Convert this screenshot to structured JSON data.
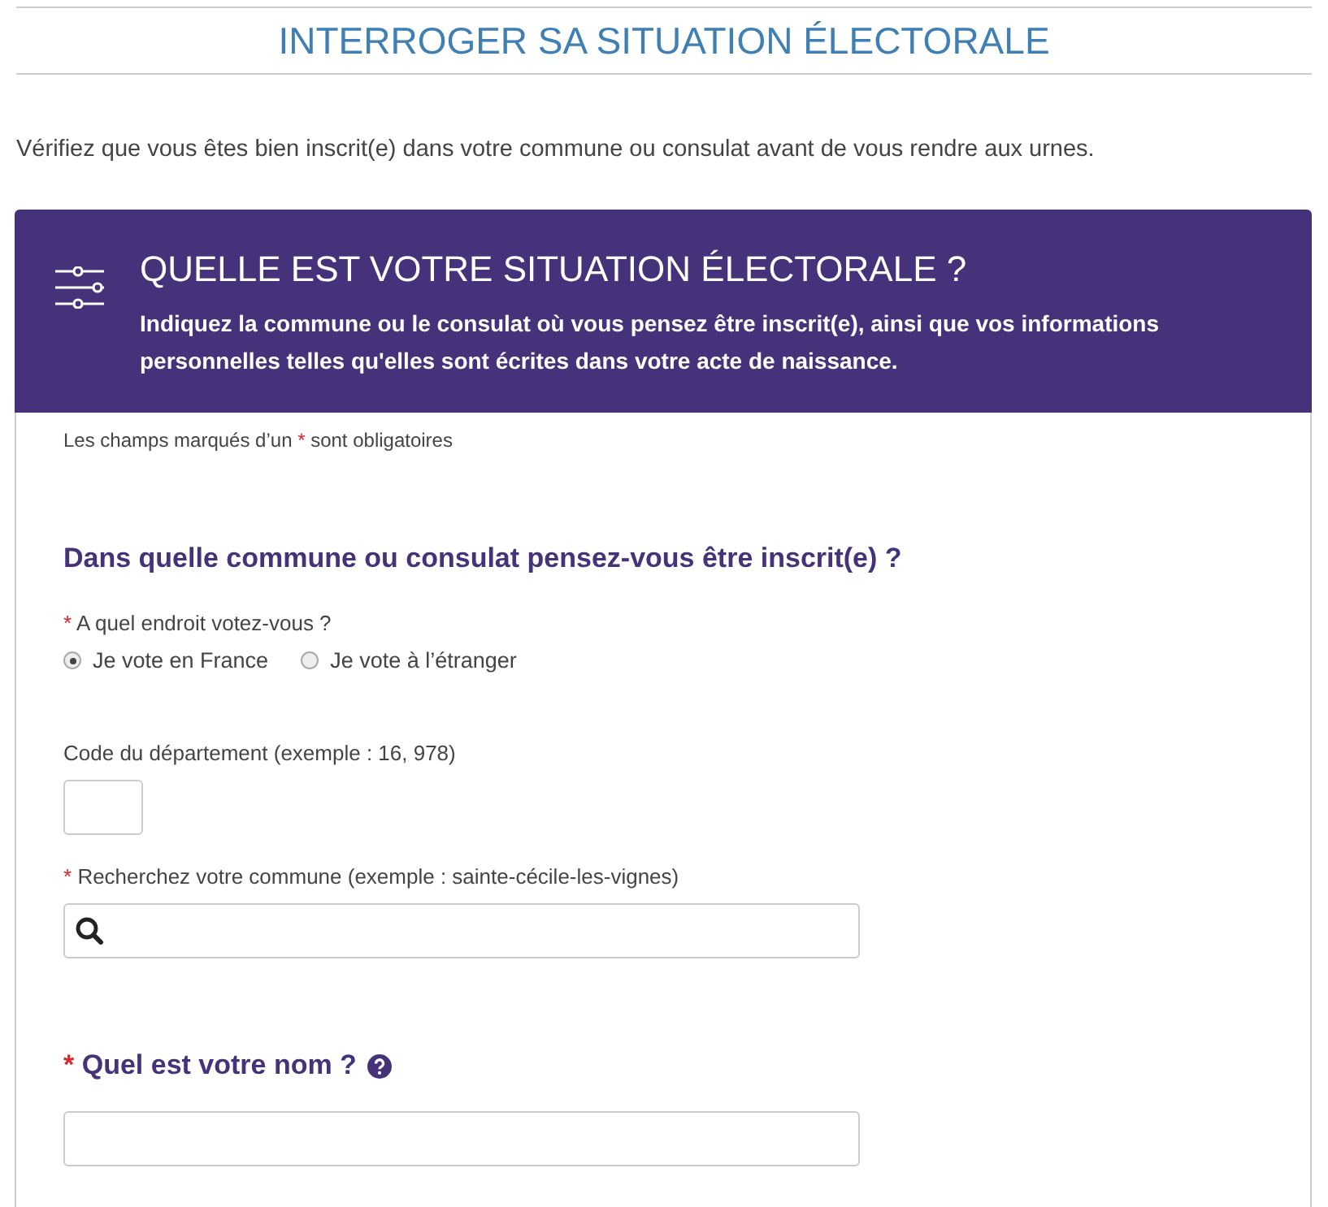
{
  "page_title": "INTERROGER SA SITUATION ÉLECTORALE",
  "intro": "Vérifiez que vous êtes bien inscrit(e) dans votre commune ou consulat avant de vous rendre aux urnes.",
  "card": {
    "title": "QUELLE EST VOTRE SITUATION ÉLECTORALE ?",
    "subtitle": "Indiquez la commune ou le consulat où vous pensez être inscrit(e), ainsi que vos informations personnelles telles qu'elles sont écrites dans votre acte de naissance."
  },
  "required_mark": "*",
  "notice": {
    "before": "Les champs marqués d’un",
    "after": "sont obligatoires"
  },
  "items": [
    {
      "kind": "heading",
      "label": "Dans quelle commune ou consulat pensez-vous être inscrit(e) ?"
    },
    {
      "kind": "radio",
      "label": "A quel endroit votez-vous ?",
      "required": true,
      "options": [
        {
          "label": "Je vote en France",
          "selected": true
        },
        {
          "label": "Je vote à l’étranger",
          "selected": false
        }
      ]
    },
    {
      "kind": "short_text",
      "label": "Code du département (exemple : 16, 978)",
      "required": false
    },
    {
      "kind": "search",
      "label": "Recherchez votre commune (exemple : sainte-cécile-les-vignes)",
      "required": true
    },
    {
      "kind": "question",
      "label": "Quel est votre nom ?",
      "required": true,
      "help": true
    }
  ]
}
